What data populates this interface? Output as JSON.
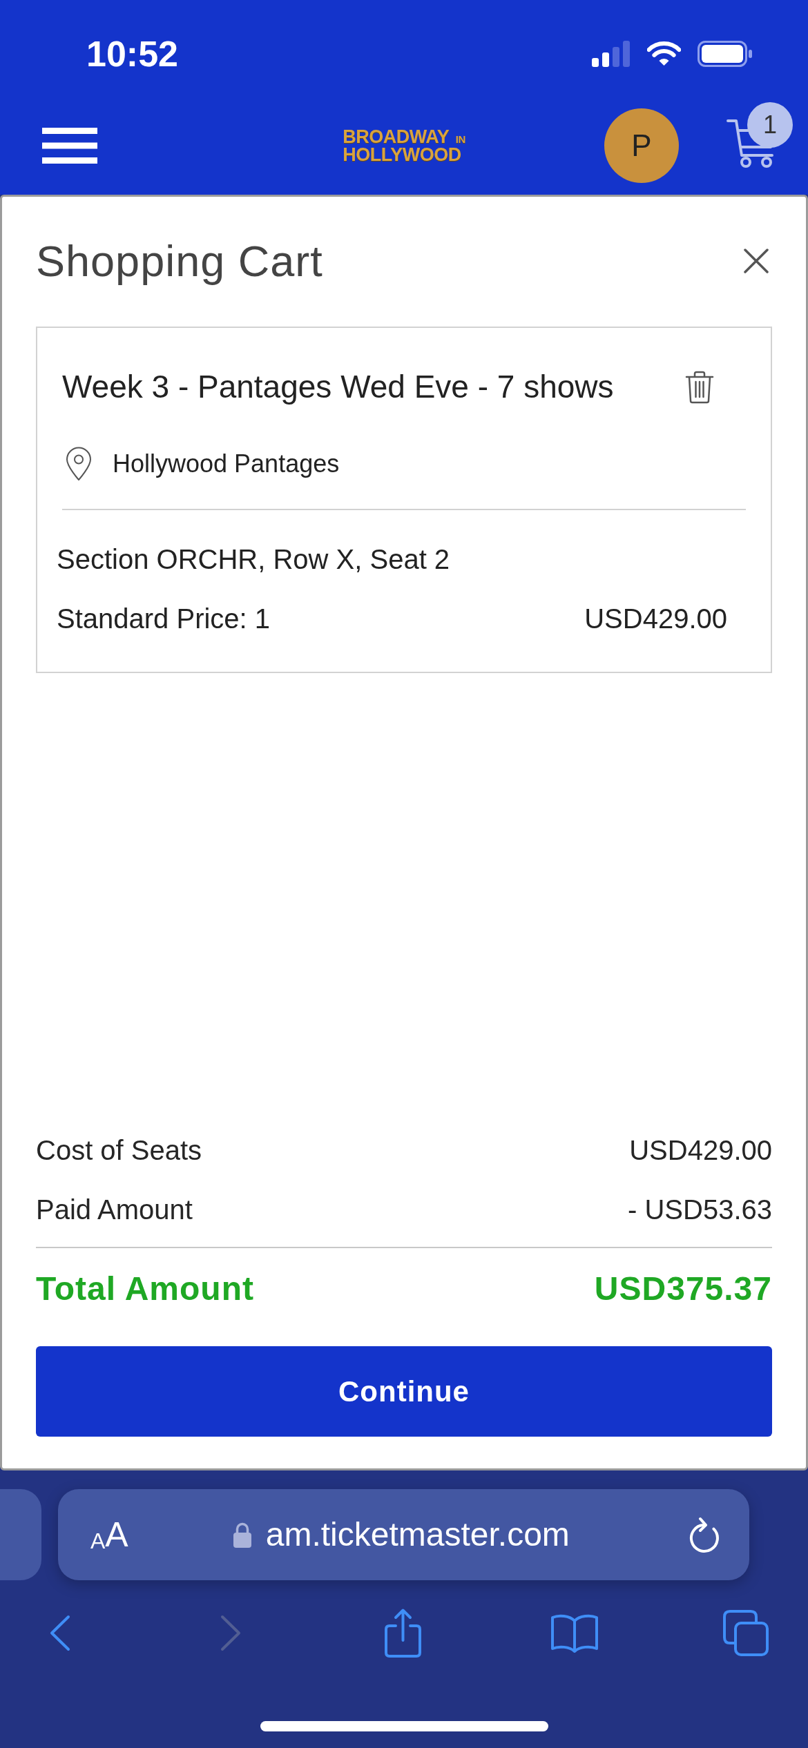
{
  "status_bar": {
    "time": "10:52"
  },
  "header": {
    "logo": {
      "line_1": "BROADWAY",
      "tag": "IN",
      "line_2": "HOLLYWOOD"
    },
    "avatar_initial": "P",
    "cart_count": "1"
  },
  "cart": {
    "title": "Shopping Cart",
    "items": [
      {
        "title": "Week 3 - Pantages Wed Eve - 7 shows",
        "venue": "Hollywood Pantages",
        "seat": "Section ORCHR, Row X, Seat 2",
        "price_label": "Standard Price: 1",
        "price": "USD429.00"
      }
    ],
    "summary": [
      {
        "kind": "line",
        "label": "Cost of Seats",
        "value": "USD429.00"
      },
      {
        "kind": "line",
        "label": "Paid Amount",
        "value": "- USD53.63"
      },
      {
        "kind": "total",
        "label": "Total Amount",
        "value": "USD375.37"
      }
    ],
    "continue_button": "Continue"
  },
  "browser": {
    "text_size_button": "AA",
    "url": "am.ticketmaster.com",
    "toolbar": [
      {
        "kind": "back",
        "disabled": false
      },
      {
        "kind": "forward",
        "disabled": true
      },
      {
        "kind": "share",
        "disabled": false
      },
      {
        "kind": "bookmarks",
        "disabled": false
      },
      {
        "kind": "tabs",
        "disabled": false
      }
    ]
  }
}
